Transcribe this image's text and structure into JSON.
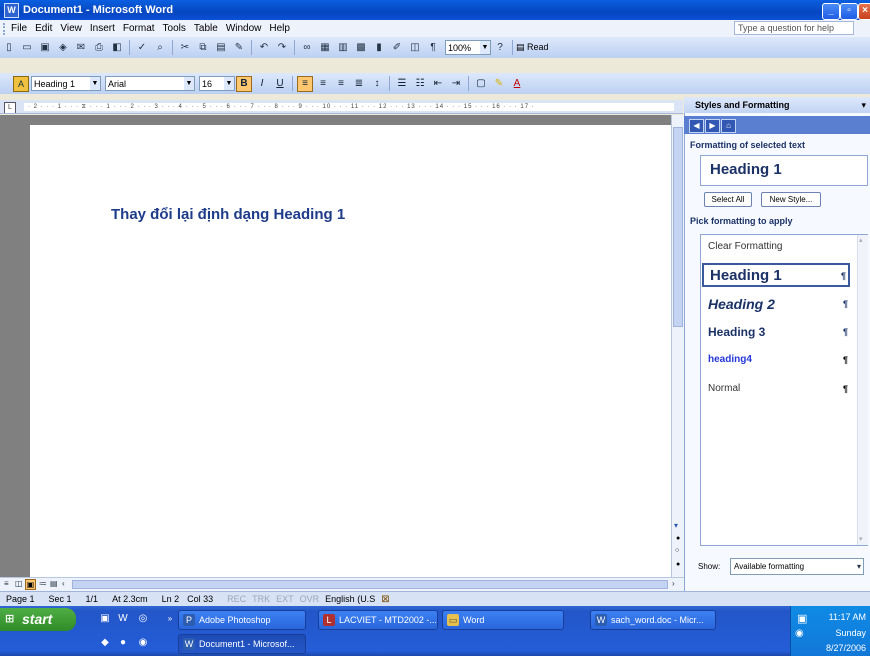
{
  "window": {
    "title": "Document1 - Microsoft Word",
    "app_icon": "W"
  },
  "menu": {
    "items": [
      "File",
      "Edit",
      "View",
      "Insert",
      "Format",
      "Tools",
      "Table",
      "Window",
      "Help"
    ],
    "help_placeholder": "Type a question for help"
  },
  "standard_toolbar": {
    "zoom": "100%",
    "read_label": "Read"
  },
  "formatting_toolbar": {
    "style": "Heading 1",
    "font": "Arial",
    "size": "16",
    "style_icon": "A"
  },
  "document": {
    "text": "Thay đổi lại định dạng Heading 1"
  },
  "task_pane": {
    "title": "Styles and Formatting",
    "selected_label": "Formatting of selected text",
    "selected_style": "Heading 1",
    "select_all": "Select All",
    "new_style": "New Style...",
    "pick_label": "Pick formatting to apply",
    "styles": [
      {
        "name": "Clear Formatting",
        "mark": ""
      },
      {
        "name": "Heading 1",
        "mark": "¶"
      },
      {
        "name": "Heading 2",
        "mark": "¶"
      },
      {
        "name": "Heading 3",
        "mark": "¶"
      },
      {
        "name": "heading4",
        "mark": "¶"
      },
      {
        "name": "Normal",
        "mark": "¶"
      }
    ],
    "show_label": "Show:",
    "show_value": "Available formatting"
  },
  "status": {
    "page": "Page 1",
    "sec": "Sec 1",
    "pages": "1/1",
    "at": "At 2.3cm",
    "ln": "Ln 2",
    "col": "Col 33",
    "rec": "REC",
    "trk": "TRK",
    "ext": "EXT",
    "ovr": "OVR",
    "lang": "English (U.S"
  },
  "taskbar": {
    "start": "start",
    "tasks": [
      "Adobe Photoshop",
      "LACVIET - MTD2002 -...",
      "Word",
      "sach_word.doc - Micr...",
      "Document1 - Microsof..."
    ],
    "time": "11:17 AM",
    "day": "Sunday",
    "date": "8/27/2006"
  }
}
